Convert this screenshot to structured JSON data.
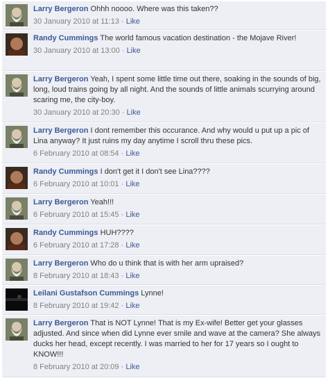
{
  "colors": {
    "link": "#3b5998",
    "comment_bg": "#edeff4",
    "meta": "#808080"
  },
  "comments": [
    {
      "author": "Larry Bergeron",
      "avatar": "larry-avatar",
      "text": "Ohhh noooo. Where was this taken??",
      "timestamp": "30 January 2010 at 11:13",
      "sep": "·",
      "like": "Like"
    },
    {
      "author": "Randy Cummings",
      "avatar": "randy-avatar",
      "text": "The world famous vacation destination - the Mojave River!",
      "timestamp": "30 January 2010 at 13:00",
      "sep": "·",
      "like": "Like"
    },
    {
      "author": "Larry Bergeron",
      "avatar": "larry-avatar",
      "text": "Yeah, I spent some little time out there, soaking in the sounds of big, long, loud trains going by all night. And the sounds of little animals scurrying around scaring me, the city-boy.",
      "timestamp": "30 January 2010 at 20:30",
      "sep": "·",
      "like": "Like"
    },
    {
      "author": "Larry Bergeron",
      "avatar": "larry-avatar",
      "text": "I dont remember this occurance. And why would u put up a pic of Lina anyway? It just ruins my day anytime I scroll thru these pics.",
      "timestamp": "6 February 2010 at 08:54",
      "sep": "·",
      "like": "Like"
    },
    {
      "author": "Randy Cummings",
      "avatar": "randy-avatar",
      "text": "I don't get it I don't see Lina????",
      "timestamp": "6 February 2010 at 10:01",
      "sep": "·",
      "like": "Like"
    },
    {
      "author": "Larry Bergeron",
      "avatar": "larry-avatar",
      "text": "Yeah!!!",
      "timestamp": "6 February 2010 at 15:45",
      "sep": "·",
      "like": "Like"
    },
    {
      "author": "Randy Cummings",
      "avatar": "randy-avatar",
      "text": "HUH????",
      "timestamp": "6 February 2010 at 17:28",
      "sep": "·",
      "like": "Like"
    },
    {
      "author": "Larry Bergeron",
      "avatar": "larry-avatar",
      "text": "Who do u think that is with her arm upraised?",
      "timestamp": "8 February 2010 at 18:43",
      "sep": "·",
      "like": "Like"
    },
    {
      "author": "Leilani Gustafson Cummings",
      "avatar": "leilani-avatar",
      "text": "Lynne!",
      "timestamp": "8 February 2010 at 19:42",
      "sep": "·",
      "like": "Like"
    },
    {
      "author": "Larry Bergeron",
      "avatar": "larry-avatar",
      "text": "That is NOT Lynne! That is my Ex-wife! Better get your glasses adjusted. And since when did Lynne ever smile and wave at the camera? She always ducks her head, except recently. I was married to her for 17 years so I ought to KNOW!!!",
      "timestamp": "8 February 2010 at 20:09",
      "sep": "·",
      "like": "Like"
    }
  ]
}
